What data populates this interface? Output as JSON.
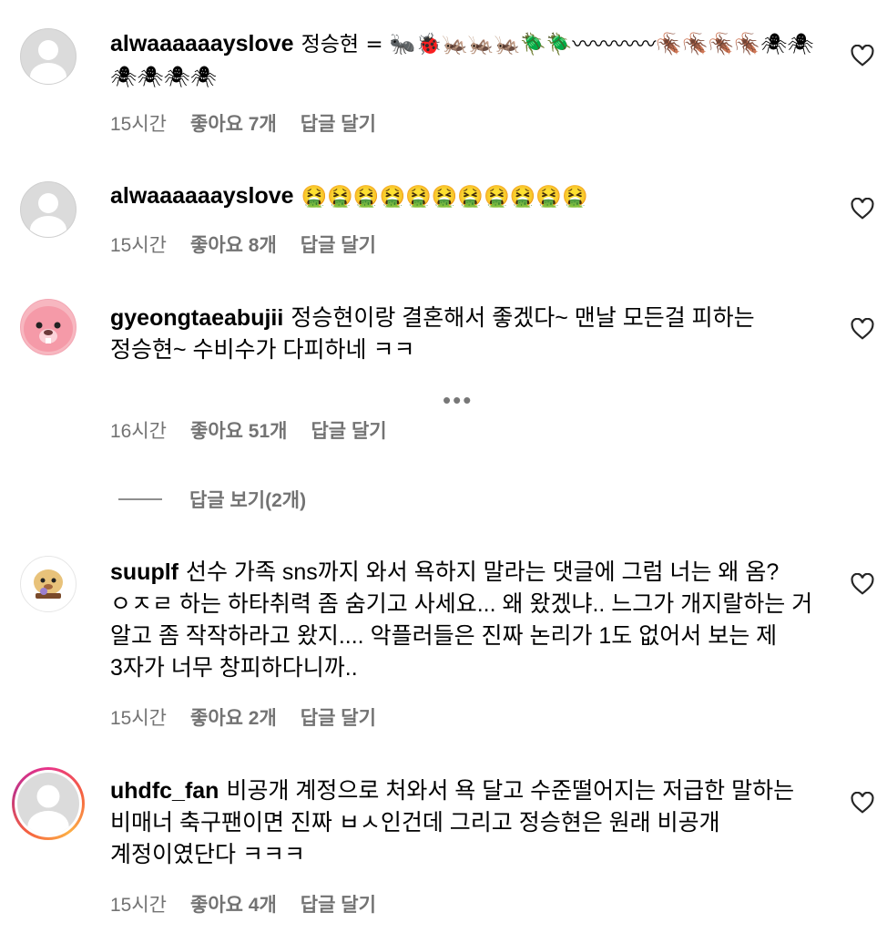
{
  "comments": [
    {
      "username": "alwaaaaaayslove",
      "text": "정승현 = 🐜🐞🦗🦗🦗🪲🪲〰〰〰〰🪳🪳🪳🪳🕷🕷🕷🕷🕷🕷",
      "time": "15시간",
      "likes": "좋아요 7개",
      "reply": "답글 달기"
    },
    {
      "username": "alwaaaaaayslove",
      "text": "🤮🤮🤮🤮🤮🤮🤮🤮🤮🤮🤮",
      "time": "15시간",
      "likes": "좋아요 8개",
      "reply": "답글 달기"
    },
    {
      "username": "gyeongtaeabujii",
      "text": "정승현이랑 결혼해서 좋겠다~ 맨날 모든걸 피하는 정승현~ 수비수가 다피하네 ㅋㅋ",
      "time": "16시간",
      "likes": "좋아요 51개",
      "reply": "답글 달기",
      "more": "•••",
      "view_replies": "답글 보기(2개)"
    },
    {
      "username": "suuplf",
      "text": "선수 가족 sns까지 와서 욕하지 말라는 댓글에 그럼 너는 왜 옴? ㅇㅈㄹ 하는 하타취력 좀 숨기고 사세요... 왜 왔겠냐.. 느그가 개지랄하는 거 알고 좀 작작하라고 왔지.... 악플러들은 진짜 논리가 1도 없어서 보는 제 3자가 너무 창피하다니까..",
      "time": "15시간",
      "likes": "좋아요 2개",
      "reply": "답글 달기"
    },
    {
      "username": "uhdfc_fan",
      "text": "비공개 계정으로 처와서 욕 달고 수준떨어지는 저급한 말하는 비매너 축구팬이면 진짜 ㅂㅅ인건데 그리고 정승현은 원래 비공개 계정이였단다 ㅋㅋㅋ",
      "time": "15시간",
      "likes": "좋아요 4개",
      "reply": "답글 달기"
    }
  ]
}
